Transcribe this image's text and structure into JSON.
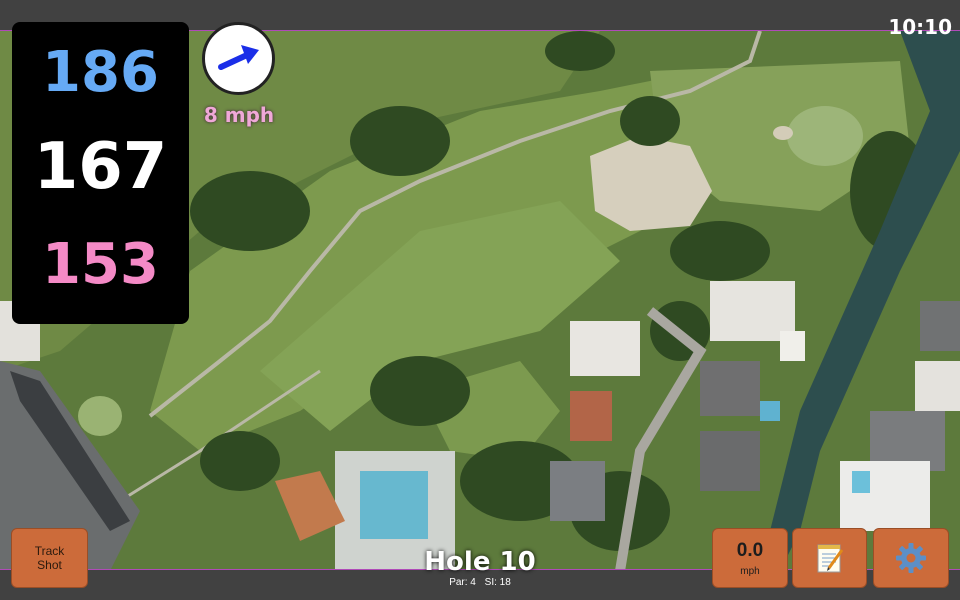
{
  "status": {
    "time": "10:10"
  },
  "yardage": {
    "back": "186",
    "center": "167",
    "front": "153"
  },
  "wind": {
    "speed": "8 mph",
    "icon": "wind-arrow-icon",
    "arrow_color": "#1a2ee8"
  },
  "buttons": {
    "track_shot": "Track Shot",
    "speed_value": "0.0",
    "speed_unit": "mph",
    "notes_icon": "notepad-icon",
    "settings_icon": "gear-icon"
  },
  "hole": {
    "title": "Hole 10",
    "par": "Par: 4",
    "si": "SI: 18"
  },
  "colors": {
    "button": "#cc6b3a",
    "back_yardage": "#66aaf5",
    "front_yardage": "#f48ac6",
    "wind_text": "#f0a8d8"
  }
}
